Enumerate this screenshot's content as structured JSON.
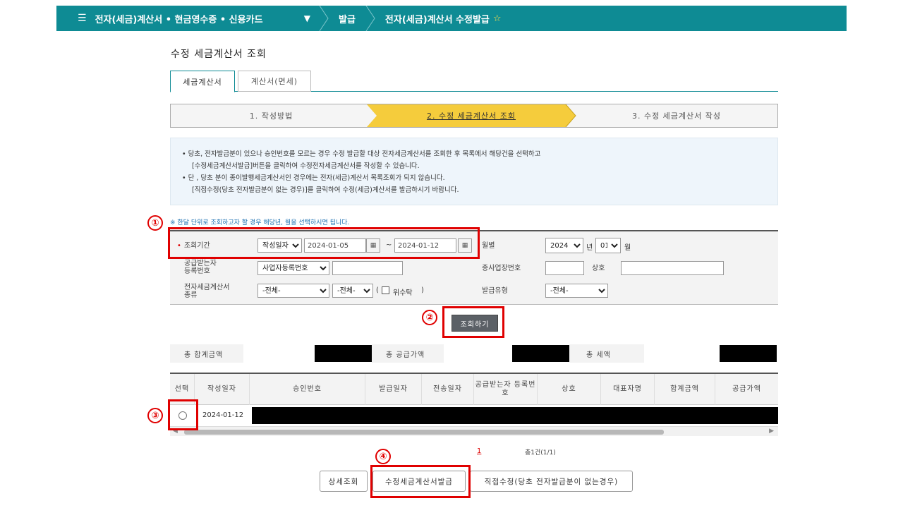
{
  "nav": {
    "menu_label": "전자(세금)계산서 • 현금영수증 • 신용카드",
    "crumb1": "발급",
    "crumb2": "전자(세금)계산서 수정발급"
  },
  "page_title": "수정 세금계산서 조회",
  "tabs": [
    {
      "label": "세금계산서",
      "active": true
    },
    {
      "label": "계산서(면세)",
      "active": false
    }
  ],
  "steps": [
    {
      "label": "1. 작성방법",
      "active": false
    },
    {
      "label": "2. 수정 세금계산서 조회",
      "active": true
    },
    {
      "label": "3. 수정 세금계산서 작성",
      "active": false
    }
  ],
  "notice": {
    "line1": "• 당초, 전자발급분이 있으나 승인번호를 모르는 경우 수정 발급할 대상 전자세금계산서를 조회한 후 목록에서 해당건을 선택하고",
    "line2": "[수정세금계산서발급]버튼을 클릭하여 수정전자세금계산서를 작성할 수 있습니다.",
    "line3": "• 단 , 당초 분이 종이발행세금계산서인 경우에는 전자(세금)계산서 목록조회가 되지 않습니다.",
    "line4": "[직접수정(당초 전자발급분이 없는 경우)]를 클릭하여 수정(세금)계산서를 발급하시기 바랍니다."
  },
  "hint": "※ 한달 단위로 조회하고자 할 경우 해당년, 월을 선택하시면 됩니다.",
  "form": {
    "period_label": "조회기간",
    "date_type": "작성일자",
    "date_from": "2024-01-05",
    "date_sep": "~",
    "date_to": "2024-01-12",
    "monthly_label": "월별",
    "year": "2024",
    "year_unit": "년",
    "month": "01",
    "month_unit": "월",
    "supplier_label_1": "공급받는자",
    "supplier_label_2": "등록번호",
    "supplier_type": "사업자등록번호",
    "branch_label": "종사업장번호",
    "company_label": "상호",
    "kind_label_1": "전자세금계산서",
    "kind_label_2": "종류",
    "kind1": "-전체-",
    "kind2": "-전체-",
    "paren_open": "(",
    "consign_label": "위수탁",
    "paren_close": ")",
    "issue_type_label": "발급유형",
    "issue_type": "-전체-"
  },
  "search_button": "조회하기",
  "totals": {
    "total_label": "총 합계금액",
    "supply_label": "총 공급가액",
    "tax_label": "총 세액"
  },
  "table": {
    "headers": [
      "선택",
      "작성일자",
      "승인번호",
      "발급일자",
      "전송일자",
      "공급받는자 등록번호",
      "상호",
      "대표자명",
      "합계금액",
      "공급가액"
    ],
    "rows": [
      {
        "date": "2024-01-12"
      }
    ]
  },
  "pager": {
    "page": "1",
    "count": "총1건(1/1)"
  },
  "buttons": {
    "detail": "상세조회",
    "issue": "수정세금계산서발급",
    "direct": "직접수정(당초 전자발급분이 없는경우)"
  },
  "annotations": [
    "①",
    "②",
    "③",
    "④"
  ],
  "colors": {
    "nav_bg": "#0e8b94",
    "step_active": "#f5cc3c",
    "highlight": "#e00000"
  }
}
